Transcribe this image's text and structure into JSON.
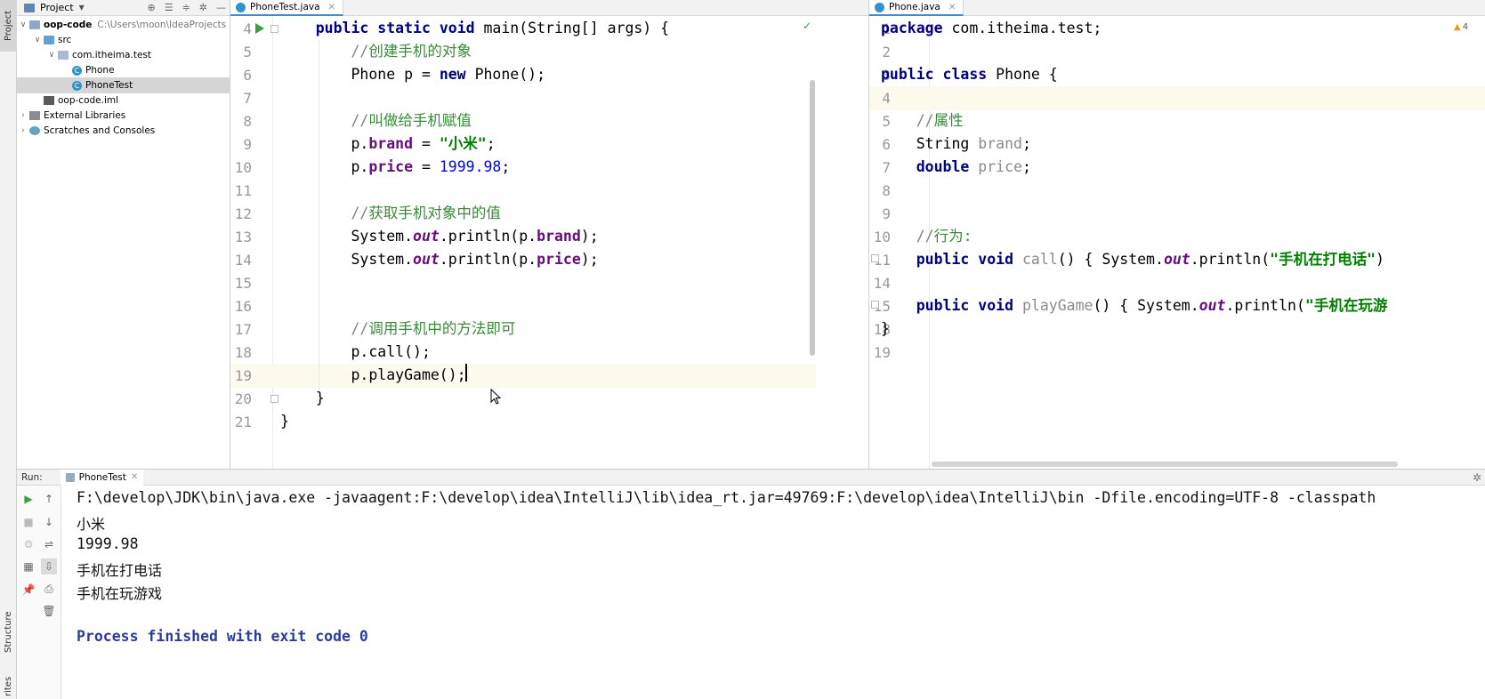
{
  "left_strip": {
    "project_tab": "Project",
    "structure_tab": "Structure",
    "favorites_tab": "rites"
  },
  "project_panel": {
    "title": "Project",
    "tree": [
      {
        "label": "oop-code",
        "path": "C:\\Users\\moon\\IdeaProjects",
        "icon": "module-folder-icon",
        "expanded": true,
        "depth": 0
      },
      {
        "label": "src",
        "icon": "source-folder-icon",
        "expanded": true,
        "depth": 1
      },
      {
        "label": "com.itheima.test",
        "icon": "package-icon",
        "expanded": true,
        "depth": 2
      },
      {
        "label": "Phone",
        "icon": "class-icon",
        "depth": 3
      },
      {
        "label": "PhoneTest",
        "icon": "class-icon",
        "depth": 3,
        "selected": true
      },
      {
        "label": "oop-code.iml",
        "icon": "iml-file-icon",
        "depth": 1
      },
      {
        "label": "External Libraries",
        "icon": "library-icon",
        "expanded": false,
        "depth": 0
      },
      {
        "label": "Scratches and Consoles",
        "icon": "scratch-icon",
        "expanded": false,
        "depth": 0
      }
    ]
  },
  "editor_left": {
    "tab": "PhoneTest.java",
    "lines": [
      {
        "no": "4",
        "tokens": [
          [
            "",
            "    "
          ],
          [
            "kw",
            "public static void "
          ],
          [
            "",
            "main(String[] args) {"
          ]
        ]
      },
      {
        "no": "5",
        "tokens": [
          [
            "",
            "        "
          ],
          [
            "cm",
            "//"
          ],
          [
            "cm-cn",
            "创建手机的对象"
          ]
        ]
      },
      {
        "no": "6",
        "tokens": [
          [
            "",
            "        Phone p = "
          ],
          [
            "kw",
            "new "
          ],
          [
            "",
            "Phone();"
          ]
        ]
      },
      {
        "no": "7",
        "tokens": []
      },
      {
        "no": "8",
        "tokens": [
          [
            "",
            "        "
          ],
          [
            "cm",
            "//"
          ],
          [
            "cm-cn",
            "叫做给手机赋值"
          ]
        ]
      },
      {
        "no": "9",
        "tokens": [
          [
            "",
            "        p."
          ],
          [
            "fld",
            "brand"
          ],
          [
            "",
            " = "
          ],
          [
            "str",
            "\"小米\""
          ],
          [
            "",
            ";"
          ]
        ]
      },
      {
        "no": "10",
        "tokens": [
          [
            "",
            "        p."
          ],
          [
            "fld",
            "price"
          ],
          [
            "",
            " = "
          ],
          [
            "num",
            "1999.98"
          ],
          [
            "",
            ";"
          ]
        ]
      },
      {
        "no": "11",
        "tokens": []
      },
      {
        "no": "12",
        "tokens": [
          [
            "",
            "        "
          ],
          [
            "cm",
            "//"
          ],
          [
            "cm-cn",
            "获取手机对象中的值"
          ]
        ]
      },
      {
        "no": "13",
        "tokens": [
          [
            "",
            "        System."
          ],
          [
            "fldi",
            "out"
          ],
          [
            "",
            ".println(p."
          ],
          [
            "fld",
            "brand"
          ],
          [
            "",
            ");"
          ]
        ]
      },
      {
        "no": "14",
        "tokens": [
          [
            "",
            "        System."
          ],
          [
            "fldi",
            "out"
          ],
          [
            "",
            ".println(p."
          ],
          [
            "fld",
            "price"
          ],
          [
            "",
            ");"
          ]
        ]
      },
      {
        "no": "15",
        "tokens": []
      },
      {
        "no": "16",
        "tokens": []
      },
      {
        "no": "17",
        "tokens": [
          [
            "",
            "        "
          ],
          [
            "cm",
            "//"
          ],
          [
            "cm-cn",
            "调用手机中的方法即可"
          ]
        ]
      },
      {
        "no": "18",
        "tokens": [
          [
            "",
            "        p.call();"
          ]
        ]
      },
      {
        "no": "19",
        "tokens": [
          [
            "",
            "        p.playGame();"
          ]
        ]
      },
      {
        "no": "20",
        "tokens": [
          [
            "",
            "    }"
          ]
        ]
      },
      {
        "no": "21",
        "tokens": [
          [
            "",
            "}"
          ]
        ]
      }
    ]
  },
  "editor_right": {
    "tab": "Phone.java",
    "inspection_count": "4",
    "lines": [
      {
        "no": "1",
        "tokens": [
          [
            "kw",
            "package "
          ],
          [
            "",
            "com.itheima.test;"
          ]
        ]
      },
      {
        "no": "2",
        "tokens": []
      },
      {
        "no": "3",
        "tokens": [
          [
            "kw",
            "public class "
          ],
          [
            "",
            "Phone {"
          ]
        ]
      },
      {
        "no": "4",
        "tokens": []
      },
      {
        "no": "5",
        "tokens": [
          [
            "",
            "    "
          ],
          [
            "cm",
            "//"
          ],
          [
            "cm-cn",
            "属性"
          ]
        ]
      },
      {
        "no": "6",
        "tokens": [
          [
            "",
            "    String "
          ],
          [
            "fld-gray",
            "brand"
          ],
          [
            "",
            ";"
          ]
        ]
      },
      {
        "no": "7",
        "tokens": [
          [
            "",
            "    "
          ],
          [
            "kw",
            "double "
          ],
          [
            "fld-gray",
            "price"
          ],
          [
            "",
            ";"
          ]
        ]
      },
      {
        "no": "8",
        "tokens": []
      },
      {
        "no": "9",
        "tokens": []
      },
      {
        "no": "10",
        "tokens": [
          [
            "",
            "    "
          ],
          [
            "cm",
            "//"
          ],
          [
            "cm-cn",
            "行为:"
          ]
        ]
      },
      {
        "no": "11",
        "tokens": [
          [
            "",
            "    "
          ],
          [
            "kw",
            "public void "
          ],
          [
            "mth-gray",
            "call"
          ],
          [
            "",
            "() { System."
          ],
          [
            "fldi",
            "out"
          ],
          [
            "",
            ".println("
          ],
          [
            "str",
            "\"手机在打电话\""
          ],
          [
            "",
            ")"
          ]
        ]
      },
      {
        "no": "14",
        "tokens": []
      },
      {
        "no": "15",
        "tokens": [
          [
            "",
            "    "
          ],
          [
            "kw",
            "public void "
          ],
          [
            "mth-gray",
            "playGame"
          ],
          [
            "",
            "() { System."
          ],
          [
            "fldi",
            "out"
          ],
          [
            "",
            ".println("
          ],
          [
            "str",
            "\"手机在玩游"
          ]
        ]
      },
      {
        "no": "18",
        "tokens": [
          [
            "",
            "}"
          ]
        ]
      },
      {
        "no": "19",
        "tokens": []
      }
    ]
  },
  "run_panel": {
    "label": "Run:",
    "tab": "PhoneTest",
    "output": [
      "F:\\develop\\JDK\\bin\\java.exe -javaagent:F:\\develop\\idea\\IntelliJ\\lib\\idea_rt.jar=49769:F:\\develop\\idea\\IntelliJ\\bin -Dfile.encoding=UTF-8 -classpath",
      "小米",
      "1999.98",
      "手机在打电话",
      "手机在玩游戏",
      "",
      "Process finished with exit code 0"
    ]
  }
}
